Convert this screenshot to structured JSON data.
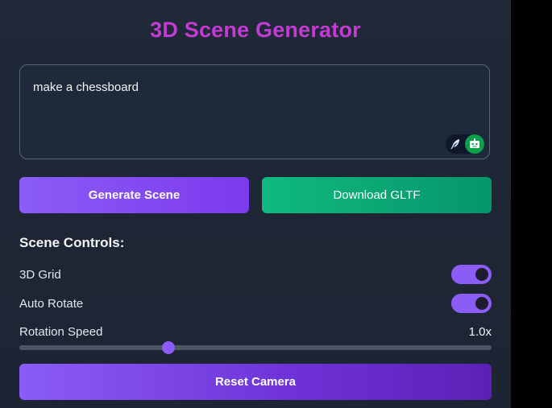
{
  "app": {
    "title": "3D Scene Generator"
  },
  "prompt": {
    "value": "make a chessboard"
  },
  "actions": {
    "generate_label": "Generate Scene",
    "download_label": "Download GLTF"
  },
  "controls": {
    "title": "Scene Controls:",
    "grid": {
      "label": "3D Grid",
      "enabled": true
    },
    "auto_rotate": {
      "label": "Auto Rotate",
      "enabled": true
    },
    "rotation_speed": {
      "label": "Rotation Speed",
      "display": "1.0x",
      "fraction": 0.316
    },
    "reset_label": "Reset Camera"
  },
  "icons": [
    "quill-icon",
    "bot-icon"
  ],
  "colors": {
    "title": "#c33bd4",
    "accent": "#8b5cf6",
    "download": "#10b981",
    "background": "#1f2937"
  }
}
